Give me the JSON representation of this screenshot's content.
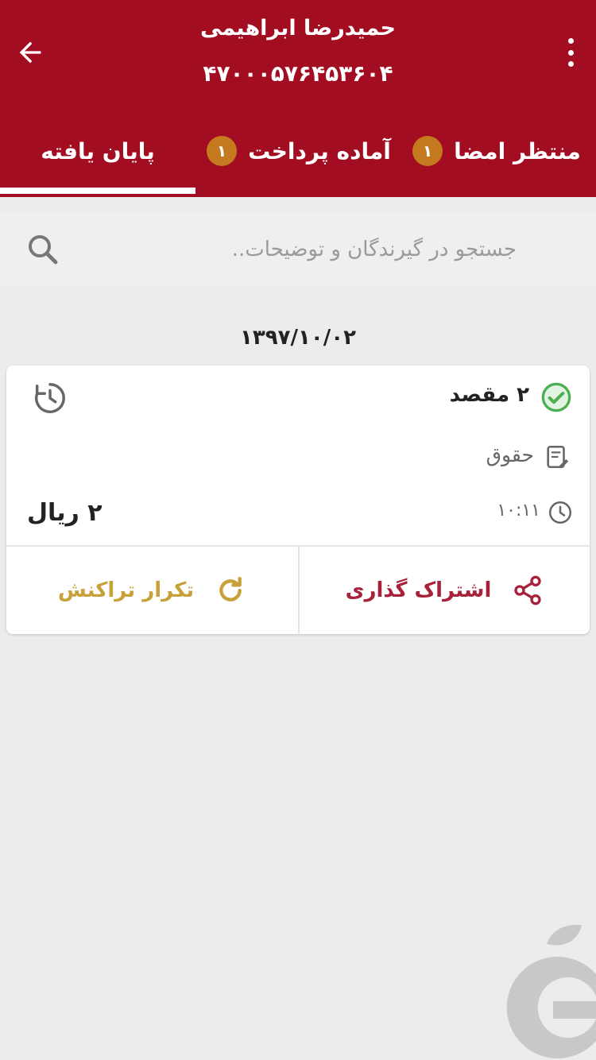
{
  "header": {
    "account_name": "حمیدرضا ابراهیمی",
    "account_number": "۴۷۰۰۰۵۷۶۴۵۳۶۰۴",
    "back_icon": "arrow-left-icon",
    "more_icon": "more-vertical-icon"
  },
  "tabs": [
    {
      "label": "منتظر امضا",
      "badge": "۱"
    },
    {
      "label": "آماده پرداخت",
      "badge": "۱"
    },
    {
      "label": "پایان یافته",
      "badge": ""
    }
  ],
  "active_tab": "پایان یافته",
  "search": {
    "placeholder": "جستجو در گیرندگان و توضیحات..",
    "value": ""
  },
  "date_heading": "۱۳۹۷/۱۰/۰۲",
  "transaction": {
    "destination": "۲ مقصد",
    "category": "حقوق",
    "time": "۱۰:۱۱",
    "amount": "۲ ریال",
    "share_label": "اشتراک گذاری",
    "repeat_label": "تکرار تراکنش"
  },
  "colors": {
    "primary": "#a30d22",
    "badge": "#c57a20",
    "success": "#4caf50",
    "share": "#a8213b",
    "repeat": "#c9a13a",
    "background": "#ececec"
  }
}
